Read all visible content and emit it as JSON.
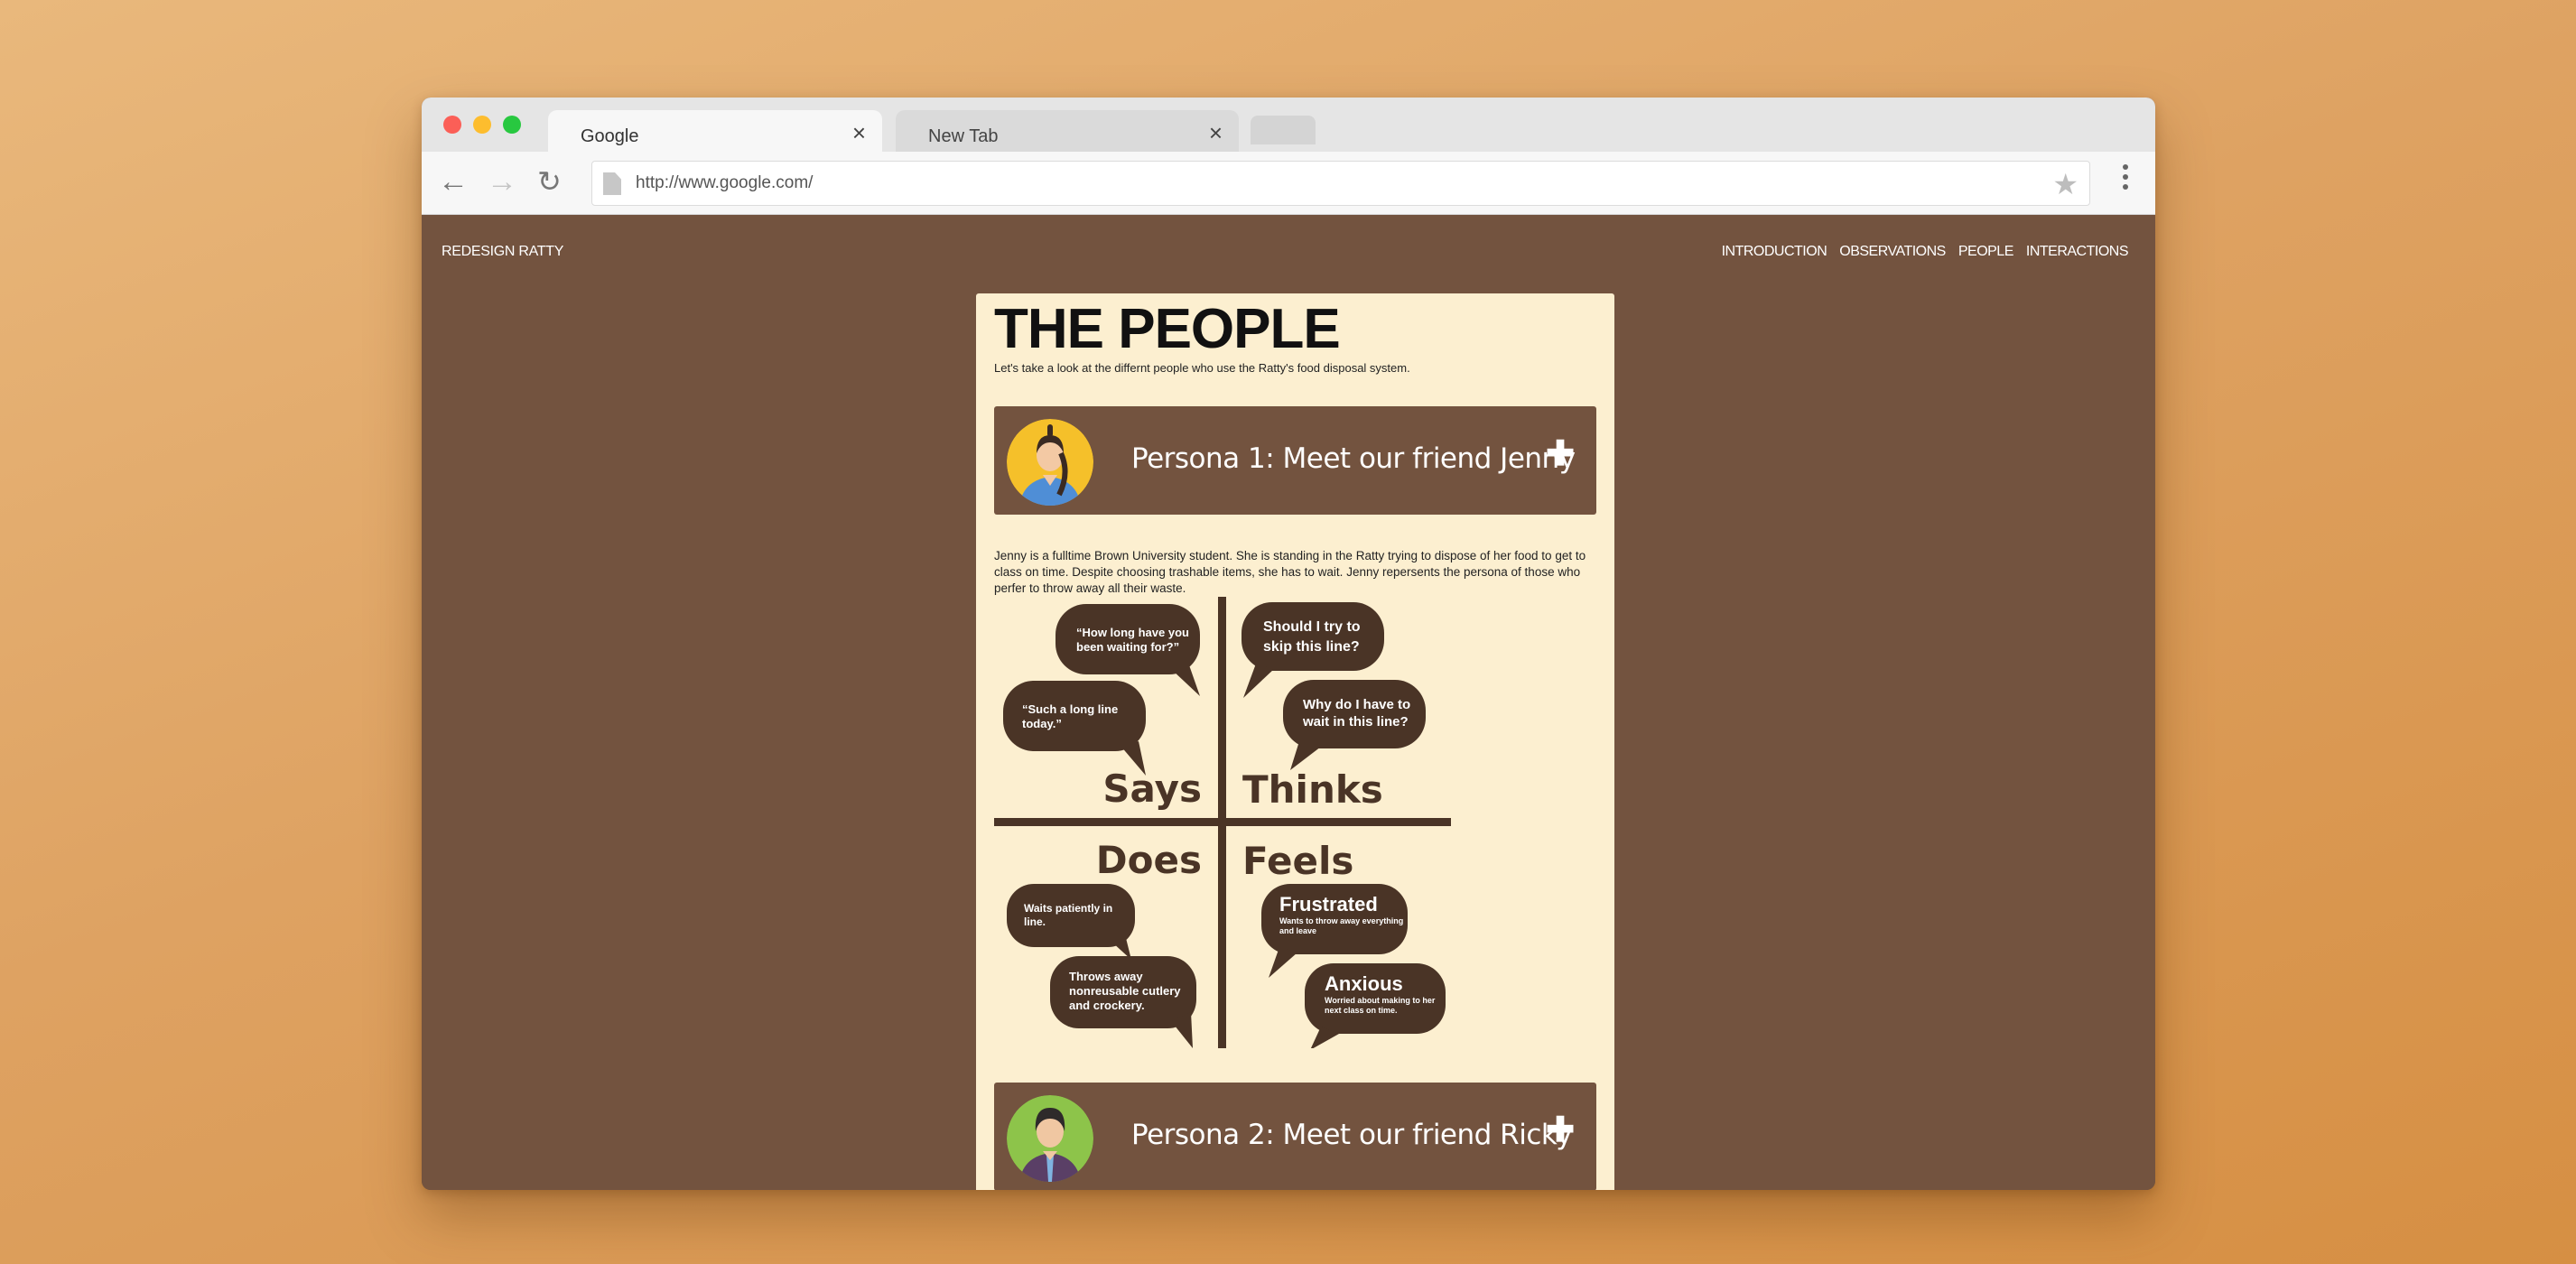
{
  "browser": {
    "tabs": [
      {
        "label": "Google"
      },
      {
        "label": "New Tab"
      }
    ],
    "url": "http://www.google.com/"
  },
  "site": {
    "brand": "REDESIGN RATTY",
    "nav": [
      "INTRODUCTION",
      "OBSERVATIONS",
      "PEOPLE",
      "INTERACTIONS"
    ]
  },
  "page": {
    "title": "THE PEOPLE",
    "intro": "Let's take a look at the differnt people who use the Ratty's food disposal system.",
    "personas": [
      {
        "label": "Persona 1: Meet our friend Jenny",
        "description": "Jenny is a fulltime Brown University student. She is standing in the Ratty trying to dispose of her food to get to class on time. Despite choosing trashable items, she has to wait. Jenny repersents the persona of those who perfer to throw away all their waste."
      },
      {
        "label": "Persona 2: Meet our friend Ricky"
      }
    ],
    "empathy_map": {
      "quadrants": {
        "says": "Says",
        "thinks": "Thinks",
        "does": "Does",
        "feels": "Feels"
      },
      "says": [
        {
          "line1": "“How long have you",
          "line2": "been waiting for?”"
        },
        {
          "line1": "“Such a long line",
          "line2": "today.”"
        }
      ],
      "thinks": [
        {
          "line1": "Should I try to",
          "line2": "skip this line?"
        },
        {
          "line1": "Why do I have to",
          "line2": "wait in this line?"
        }
      ],
      "does": [
        {
          "line1": "Waits patiently in",
          "line2": "line."
        },
        {
          "line1": "Throws away",
          "line2": "nonreusable cutlery",
          "line3": "and crockery."
        }
      ],
      "feels": [
        {
          "heading": "Frustrated",
          "sub1": "Wants to throw away everything",
          "sub2": "and leave"
        },
        {
          "heading": "Anxious",
          "sub1": "Worried about making to her",
          "sub2": "next class on time."
        }
      ]
    }
  },
  "colors": {
    "page_bg": "#73533f",
    "card_bg": "#fcefd0",
    "bubble": "#4a3426"
  }
}
